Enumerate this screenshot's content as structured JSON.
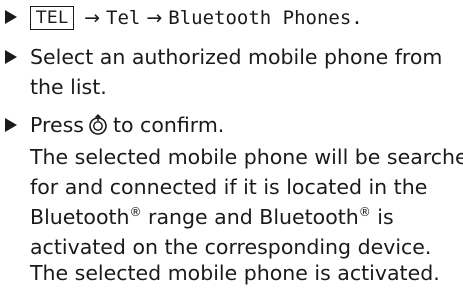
{
  "steps": [
    {
      "key_label": "TEL",
      "arrow_1": "→",
      "item_1": "Tel",
      "arrow_2": "→",
      "item_2": "Bluetooth Phones."
    },
    {
      "line_1": "Select an authorized mobile phone from",
      "line_2": "the list."
    },
    {
      "text_before": "Press",
      "icon": "controller-knob-icon",
      "text_after": "to confirm."
    }
  ],
  "result": {
    "line_1": "The selected mobile phone will be searched",
    "line_2": "for and connected if it is located in the",
    "line_3a": "Bluetooth",
    "line_3_reg": "®",
    "line_3b": " range and Bluetooth",
    "line_3_reg2": "®",
    "line_3c": " is",
    "line_4": "activated on the corresponding device."
  },
  "outcome": "The selected mobile phone is activated."
}
